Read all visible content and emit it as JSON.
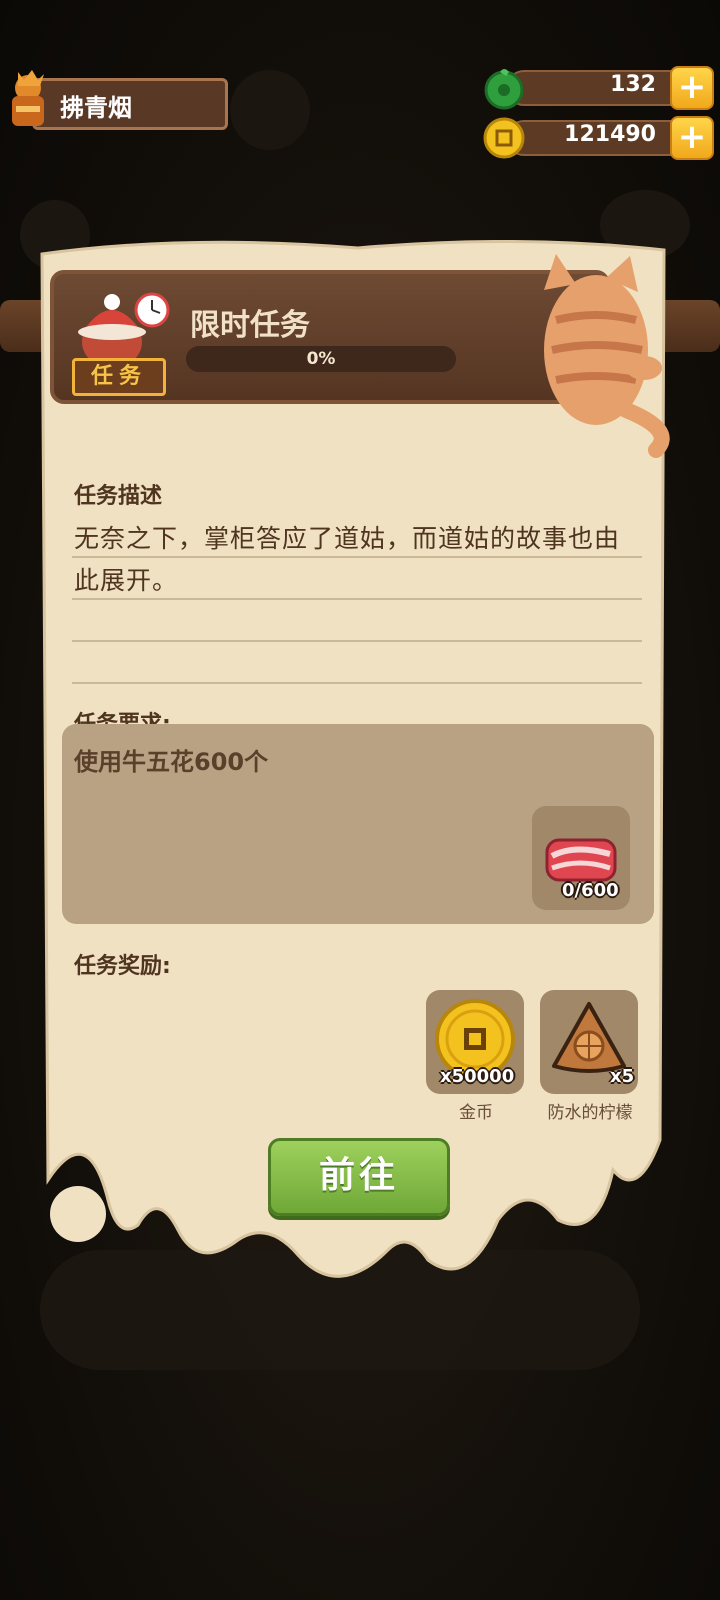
{
  "player": {
    "name": "拂青烟"
  },
  "currency": {
    "jade": {
      "value": "132",
      "icon": "jade-token-icon"
    },
    "coins": {
      "value": "121490",
      "icon": "coin-icon"
    }
  },
  "task": {
    "badge": "任务",
    "title": "限时任务",
    "progress": 0,
    "progress_text": "0%",
    "description_label": "任务描述",
    "description": "无奈之下，掌柜答应了道姑，而道姑的故事也由此展开。",
    "requirement_label": "任务要求:",
    "requirement": "使用牛五花600个",
    "requirement_item": {
      "icon": "pork-belly-icon",
      "count": "0/600"
    },
    "reward_label": "任务奖励:",
    "rewards": [
      {
        "icon": "coin-icon",
        "count": "x50000",
        "name": "金币"
      },
      {
        "icon": "lemon-chip-icon",
        "count": "x5",
        "name": "防水的柠檬"
      }
    ],
    "go_button": "前往"
  }
}
